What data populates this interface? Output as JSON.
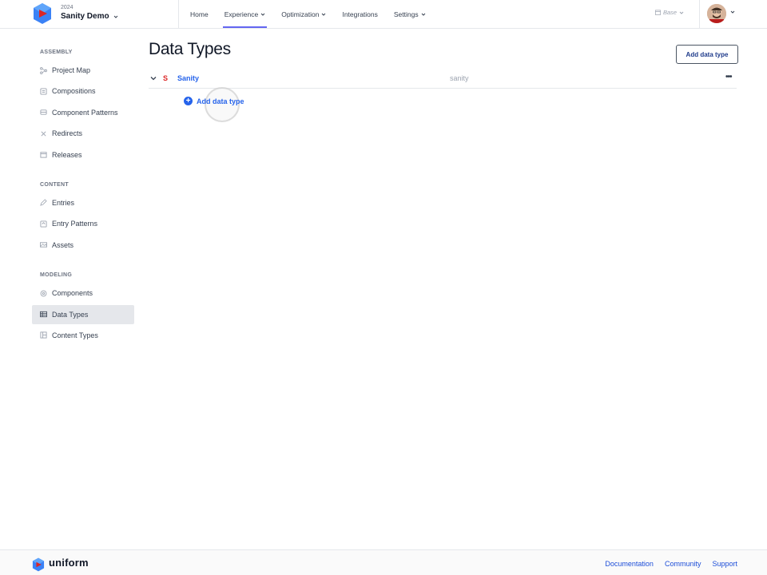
{
  "header": {
    "project_year": "2024",
    "project_name": "Sanity Demo",
    "nav": [
      {
        "label": "Home"
      },
      {
        "label": "Experience"
      },
      {
        "label": "Optimization"
      },
      {
        "label": "Integrations"
      },
      {
        "label": "Settings"
      }
    ],
    "branch_label": "Base"
  },
  "sidebar": {
    "sections": [
      {
        "label": "ASSEMBLY",
        "items": [
          {
            "label": "Project Map",
            "icon": "project-map-icon"
          },
          {
            "label": "Compositions",
            "icon": "compositions-icon"
          },
          {
            "label": "Component Patterns",
            "icon": "component-patterns-icon"
          },
          {
            "label": "Redirects",
            "icon": "redirects-icon"
          },
          {
            "label": "Releases",
            "icon": "releases-icon"
          }
        ]
      },
      {
        "label": "CONTENT",
        "items": [
          {
            "label": "Entries",
            "icon": "entries-icon"
          },
          {
            "label": "Entry Patterns",
            "icon": "entry-patterns-icon"
          },
          {
            "label": "Assets",
            "icon": "assets-icon"
          }
        ]
      },
      {
        "label": "MODELING",
        "items": [
          {
            "label": "Components",
            "icon": "components-icon"
          },
          {
            "label": "Data Types",
            "icon": "data-types-icon",
            "active": true
          },
          {
            "label": "Content Types",
            "icon": "content-types-icon"
          }
        ]
      }
    ]
  },
  "main": {
    "title": "Data Types",
    "add_button": "Add data type",
    "row": {
      "icon_letter": "S",
      "name": "Sanity",
      "id": "sanity"
    },
    "add_inline": "Add data type"
  },
  "footer": {
    "brand": "uniform",
    "links": [
      "Documentation",
      "Community",
      "Support"
    ]
  },
  "colors": {
    "accent": "#2563eb",
    "nav_underline": "#6366f1",
    "sanity_red": "#dc2626"
  }
}
